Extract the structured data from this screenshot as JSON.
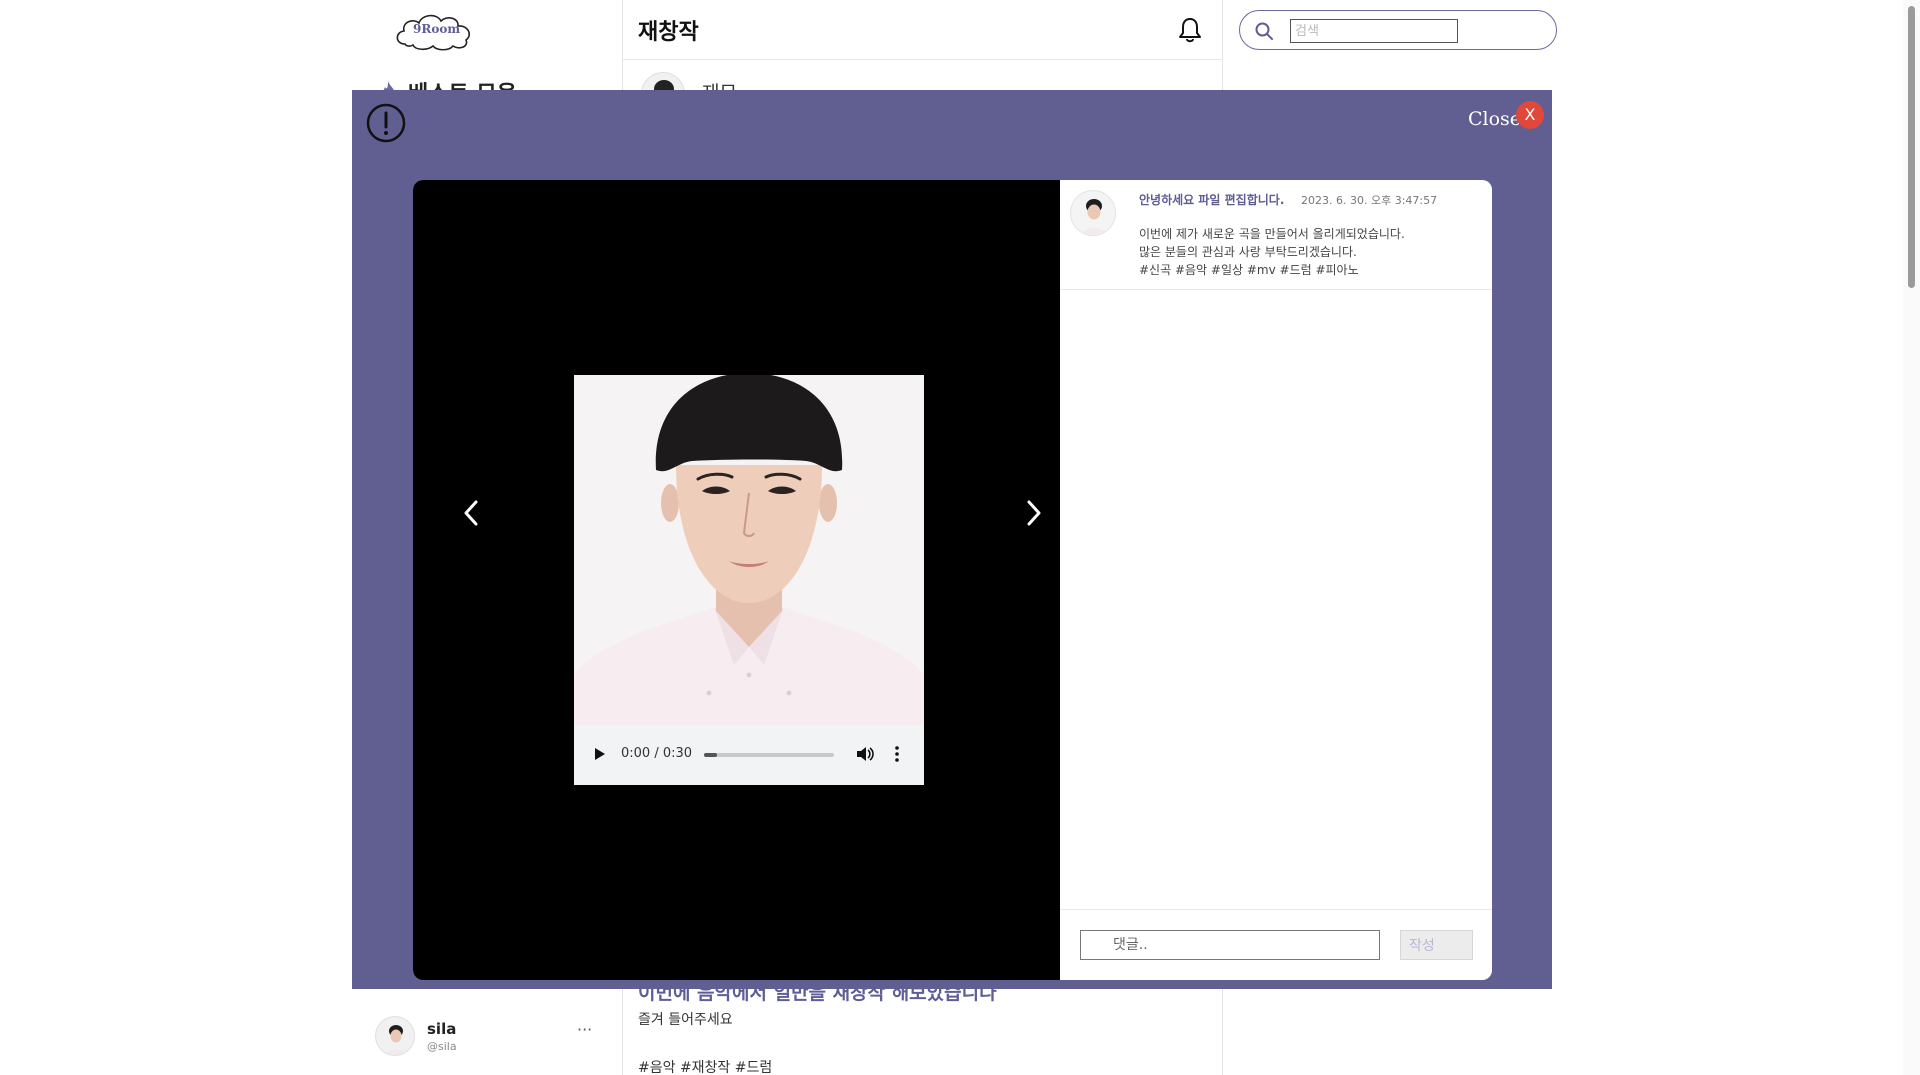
{
  "app": {
    "logo_text": "9Room"
  },
  "sidebar": {
    "nav_item_label": "베스트 모음",
    "user": {
      "name": "sila",
      "handle": "@sila",
      "more_label": "···"
    }
  },
  "header": {
    "title": "재창작"
  },
  "search": {
    "placeholder": "검색"
  },
  "background_post": {
    "head_text": "재모",
    "title": "이번에 음악에서 일반을 재창작 해보았습니다",
    "body": "즐겨 들어주세요",
    "tags": "#음악 #재창작 #드럼"
  },
  "modal": {
    "close_label": "Close",
    "close_x": "X",
    "post": {
      "title": "안녕하세요 파일 편집합니다.",
      "date": "2023. 6. 30. 오후 3:47:57",
      "lines": [
        "이번에 제가 새로운 곡을 만들어서 올리게되었습니다.",
        "많은 분들의 관심과 사랑 부탁드리겠습니다.",
        "#신곡 #음악 #일상 #mv #드럼 #피아노"
      ]
    },
    "audio": {
      "time": "0:00 / 0:30",
      "progress_fraction": 0.1
    },
    "comment": {
      "placeholder": "댓글..",
      "submit_label": "작성"
    }
  },
  "colors": {
    "overlay": "#615f92",
    "accent": "#5f5d96",
    "close_button": "#e0483b"
  },
  "icons": [
    "logo-cloud",
    "flame-icon",
    "bell-icon",
    "search-icon",
    "warning-icon",
    "chevron-left-icon",
    "chevron-right-icon",
    "play-icon",
    "volume-icon",
    "more-vertical-icon"
  ]
}
